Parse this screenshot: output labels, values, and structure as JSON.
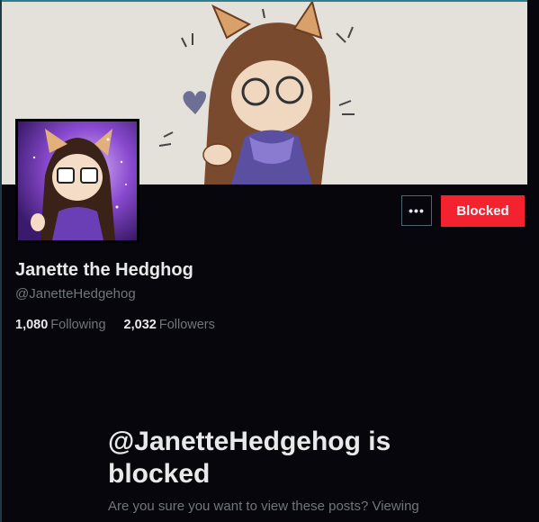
{
  "profile": {
    "display_name": "Janette the Hedghog",
    "handle": "@JanetteHedgehog",
    "following_count": "1,080",
    "following_label": "Following",
    "followers_count": "2,032",
    "followers_label": "Followers"
  },
  "actions": {
    "more_label": "•••",
    "blocked_label": "Blocked"
  },
  "blocked_notice": {
    "title": "@JanetteHedgehog is blocked",
    "description": "Are you sure you want to view these posts? Viewing"
  },
  "colors": {
    "background": "#07060d",
    "blocked_red": "#f4212e",
    "text_primary": "#e7e9ea",
    "text_secondary": "#71767b"
  },
  "icons": {
    "more": "more-horizontal-icon"
  }
}
